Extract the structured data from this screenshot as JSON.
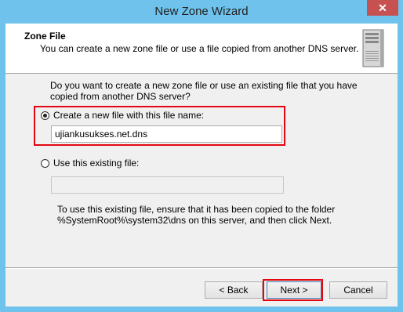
{
  "window": {
    "title": "New Zone Wizard",
    "close_glyph": "✕"
  },
  "header": {
    "title": "Zone File",
    "subtitle": "You can create a new zone file or use a file copied from another DNS server.",
    "icon": "server-icon"
  },
  "question": "Do you want to create a new zone file or use an existing file that you have copied from another DNS server?",
  "options": {
    "create_new": {
      "label": "Create a new file with this file name:",
      "checked": true,
      "value": "ujiankusukses.net.dns"
    },
    "use_existing": {
      "label": "Use this existing file:",
      "checked": false,
      "value": ""
    }
  },
  "note": "To use this existing file, ensure that it has been copied to the folder %SystemRoot%\\system32\\dns on this server, and then click Next.",
  "buttons": {
    "back": "< Back",
    "next": "Next >",
    "cancel": "Cancel"
  },
  "highlight_color": "#e30613"
}
